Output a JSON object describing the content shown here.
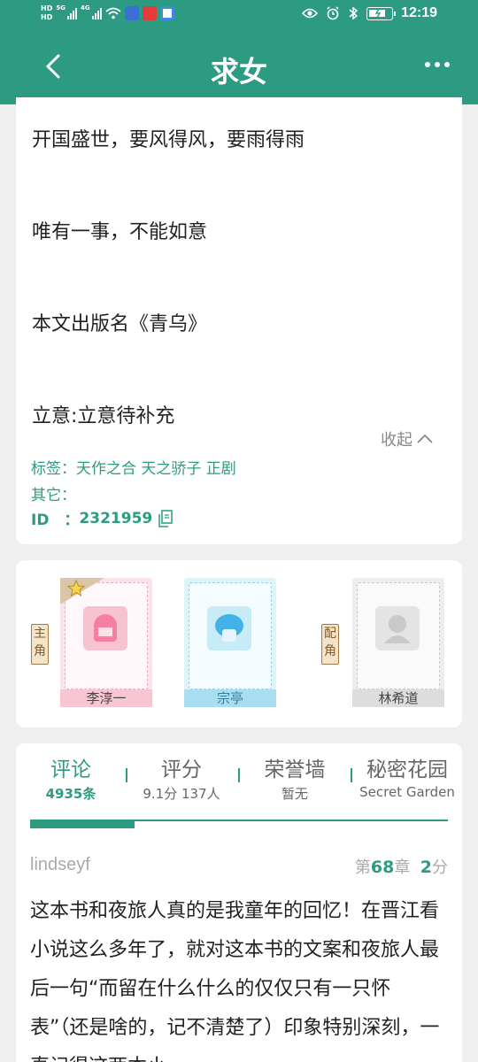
{
  "status_bar": {
    "network_labels": [
      "HD",
      "HD"
    ],
    "signal_labels": [
      "5G",
      "4G"
    ],
    "time": "12:19",
    "icons": [
      "signal-icon",
      "wifi-icon",
      "app-notification-icons",
      "eye-icon",
      "alarm-icon",
      "bluetooth-icon",
      "battery-icon"
    ]
  },
  "nav": {
    "title": "求女",
    "back_icon": "chevron-left-icon",
    "more_icon": "more-icon"
  },
  "intro": {
    "lines": [
      "开国盛世，要风得风，要雨得雨",
      "唯有一事，不能如意",
      "本文出版名《青乌》",
      "立意:立意待补充"
    ],
    "collapse_label": "收起"
  },
  "meta": {
    "tags_label": "标签：",
    "tags": "天作之合 天之骄子 正剧",
    "other_label": "其它：",
    "id_label": "ID　：",
    "id_value": "2321959"
  },
  "roles": {
    "main_label": "主角",
    "supporting_label": "配角",
    "main": [
      {
        "name": "李淳一",
        "color": "#f2b7c6"
      },
      {
        "name": "宗亭",
        "color": "#8fd3ea"
      }
    ],
    "supporting": [
      {
        "name": "林希道",
        "color": "#cccccc"
      }
    ]
  },
  "tabs": [
    {
      "title": "评论",
      "sub": "4935条",
      "active": true
    },
    {
      "title": "评分",
      "sub": "9.1分 137人",
      "active": false
    },
    {
      "title": "荣誉墙",
      "sub": "暂无",
      "active": false
    },
    {
      "title": "秘密花园",
      "sub": "Secret Garden",
      "active": false
    }
  ],
  "comment": {
    "user": "lindseyf",
    "chapter_prefix": "第",
    "chapter_num": "68",
    "chapter_suffix": "章",
    "score_num": "2",
    "score_suffix": "分",
    "body": "这本书和夜旅人真的是我童年的回忆！在晋江看小说这么多年了，就对这本书的文案和夜旅人最后一句“而留在什么什么的仅仅只有一只怀表”（还是啥的，记不清楚了）印象特别深刻，一直记得这两本小"
  },
  "colors": {
    "accent": "#2d9b82"
  }
}
